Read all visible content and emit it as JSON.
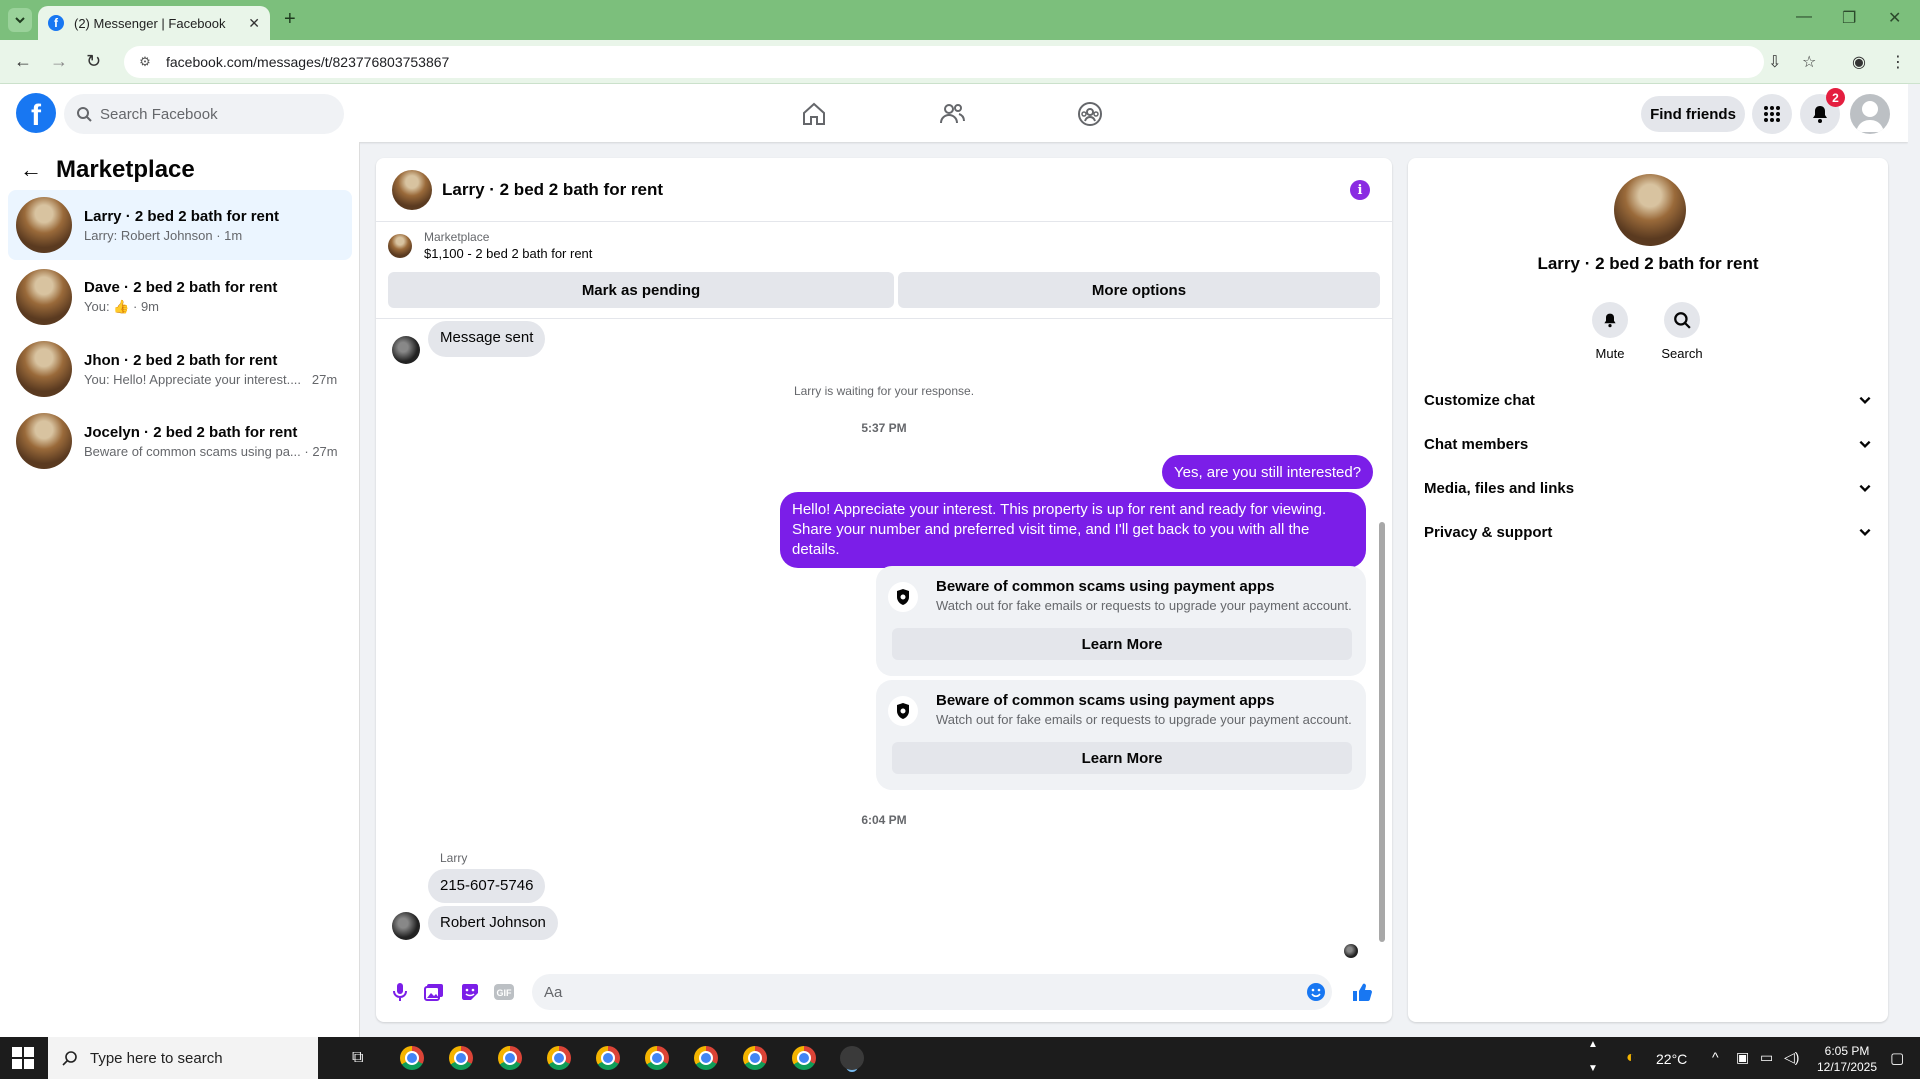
{
  "browser": {
    "tab_title": "(2) Messenger | Facebook",
    "url": "facebook.com/messages/t/823776803753867"
  },
  "header": {
    "search_placeholder": "Search Facebook",
    "find_friends": "Find friends",
    "notification_count": "2"
  },
  "sidebar": {
    "title": "Marketplace",
    "conversations": [
      {
        "name": "Larry · 2 bed 2 bath for rent",
        "preview": "Larry: Robert Johnson · 1m"
      },
      {
        "name": "Dave · 2 bed 2 bath for rent",
        "preview_prefix": "You:",
        "preview_suffix": "· 9m"
      },
      {
        "name": "Jhon · 2 bed 2 bath for rent",
        "preview": "You: Hello! Appreciate your interest....",
        "time": "27m"
      },
      {
        "name": "Jocelyn · 2 bed 2 bath for rent",
        "preview": "Beware of common scams using pa... · 27m"
      }
    ]
  },
  "chat": {
    "title": "Larry · 2 bed 2 bath for rent",
    "marketplace_label": "Marketplace",
    "listing": "$1,100 - 2 bed 2 bath for rent",
    "mark_pending": "Mark as pending",
    "more_options": "More options",
    "msg_sent": "Message sent",
    "waiting": "Larry is waiting for your response.",
    "time1": "5:37 PM",
    "sent1": "Yes, are you still interested?",
    "sent2": "Hello! Appreciate your interest. This property is up for rent and ready for viewing. Share your number and preferred visit time, and I'll get back to you with all the details.",
    "scam_title": "Beware of common scams using payment apps",
    "scam_text": "Watch out for fake emails or requests to upgrade your payment account.",
    "learn_more": "Learn More",
    "time2": "6:04 PM",
    "sender_label": "Larry",
    "recv1": "215-607-5746",
    "recv2": "Robert Johnson",
    "composer_placeholder": "Aa"
  },
  "right_panel": {
    "title": "Larry · 2 bed 2 bath for rent",
    "mute": "Mute",
    "search": "Search",
    "sections": [
      "Customize chat",
      "Chat members",
      "Media, files and links",
      "Privacy & support"
    ]
  },
  "taskbar": {
    "search_placeholder": "Type here to search",
    "weather": "22°C",
    "time": "6:05 PM",
    "date": "12/17/2025"
  },
  "colors": {
    "accent": "#7b1ee8",
    "facebook_blue": "#1877f2",
    "browser_frame": "#7cbf7c"
  }
}
